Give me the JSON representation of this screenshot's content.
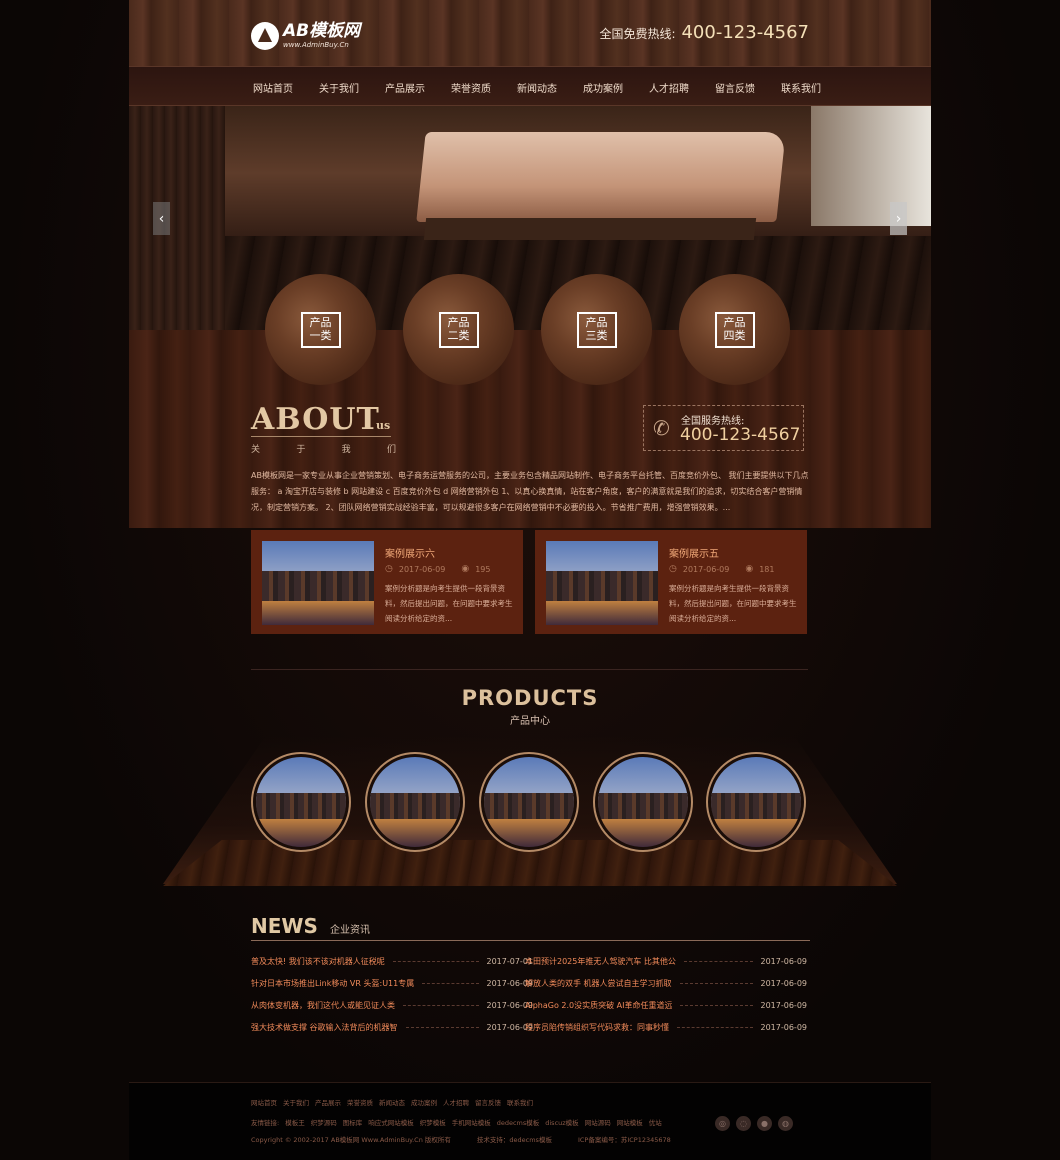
{
  "header": {
    "logo_main": "AB模板网",
    "logo_sub": "www.AdminBuy.Cn",
    "hotline_label": "全国免费热线:",
    "hotline_number": "400-123-4567"
  },
  "nav": {
    "items": [
      "网站首页",
      "关于我们",
      "产品展示",
      "荣誉资质",
      "新闻动态",
      "成功案例",
      "人才招聘",
      "留言反馈",
      "联系我们"
    ]
  },
  "banner": {
    "prev_icon": "chevron-left-icon",
    "next_icon": "chevron-right-icon"
  },
  "categories": [
    {
      "label": "产品一类"
    },
    {
      "label": "产品二类"
    },
    {
      "label": "产品三类"
    },
    {
      "label": "产品四类"
    }
  ],
  "about": {
    "title": "ABOUT",
    "title_suffix": "us",
    "subtitle_chars": [
      "关",
      "于",
      "我",
      "们"
    ],
    "hotline_label": "全国服务热线:",
    "hotline_number": "400-123-4567",
    "text": "AB模板网是一家专业从事企业营销策划、电子商务运营服务的公司，主要业务包含精品网站制作、电子商务平台托管、百度竞价外包、 我们主要提供以下几点服务： a 淘宝开店与装修 b 网站建设 c 百度竞价外包 d 网络营销外包 1、以真心换真情，站在客户角度，客户的满意就是我们的追求，切实结合客户营销情况，制定营销方案。 2、团队网络营销实战经验丰富，可以规避很多客户在网络营销中不必要的投入。节省推广费用，增强营销效果。..."
  },
  "cases": [
    {
      "title": "案例展示六",
      "date": "2017-06-09",
      "views": "195",
      "desc": "案例分析题是向考生提供一段背景资料，然后提出问题，在问题中要求考生阅读分析给定的资..."
    },
    {
      "title": "案例展示五",
      "date": "2017-06-09",
      "views": "181",
      "desc": "案例分析题是向考生提供一段背景资料，然后提出问题，在问题中要求考生阅读分析给定的资..."
    }
  ],
  "products": {
    "title": "PRODUCTS",
    "subtitle": "产品中心",
    "count": 5
  },
  "news": {
    "title": "NEWS",
    "subtitle": "企业资讯",
    "left": [
      {
        "title": "普及太快! 我们该不该对机器人征税呢",
        "date": "2017-07-01"
      },
      {
        "title": "针对日本市场推出Link移动 VR 头盔:U11专属",
        "date": "2017-06-09"
      },
      {
        "title": "从肉体变机器，我们这代人或能见证人类",
        "date": "2017-06-09"
      },
      {
        "title": "强大技术做支撑 谷歌输入法背后的机器智",
        "date": "2017-06-09"
      }
    ],
    "right": [
      {
        "title": "本田预计2025年推无人驾驶汽车 比其他公",
        "date": "2017-06-09"
      },
      {
        "title": "解放人类的双手 机器人尝试自主学习抓取",
        "date": "2017-06-09"
      },
      {
        "title": "AlphaGo 2.0没实质突破 AI革命任重道远",
        "date": "2017-06-09"
      },
      {
        "title": "程序员陷传销组织写代码求救：同事秒懂",
        "date": "2017-06-09"
      }
    ]
  },
  "footer": {
    "nav": [
      "网站首页",
      "关于我们",
      "产品展示",
      "荣誉资质",
      "新闻动态",
      "成功案例",
      "人才招聘",
      "留言反馈",
      "联系我们"
    ],
    "links_label": "友情链接:",
    "links": [
      "模板王",
      "织梦源码",
      "图标库",
      "响应式网站模板",
      "织梦模板",
      "手机网站模板",
      "dedecms模板",
      "discuz模板",
      "网站源码",
      "网站模板",
      "优站"
    ],
    "copyright": "Copyright © 2002-2017 AB模板网 Www.AdminBuy.Cn 版权所有",
    "support": "技术支持：dedecms模板",
    "icp": "ICP备案编号：苏ICP12345678",
    "social_icons": [
      "weibo-icon",
      "tencent-weibo-icon",
      "wechat-icon",
      "qq-icon"
    ]
  }
}
